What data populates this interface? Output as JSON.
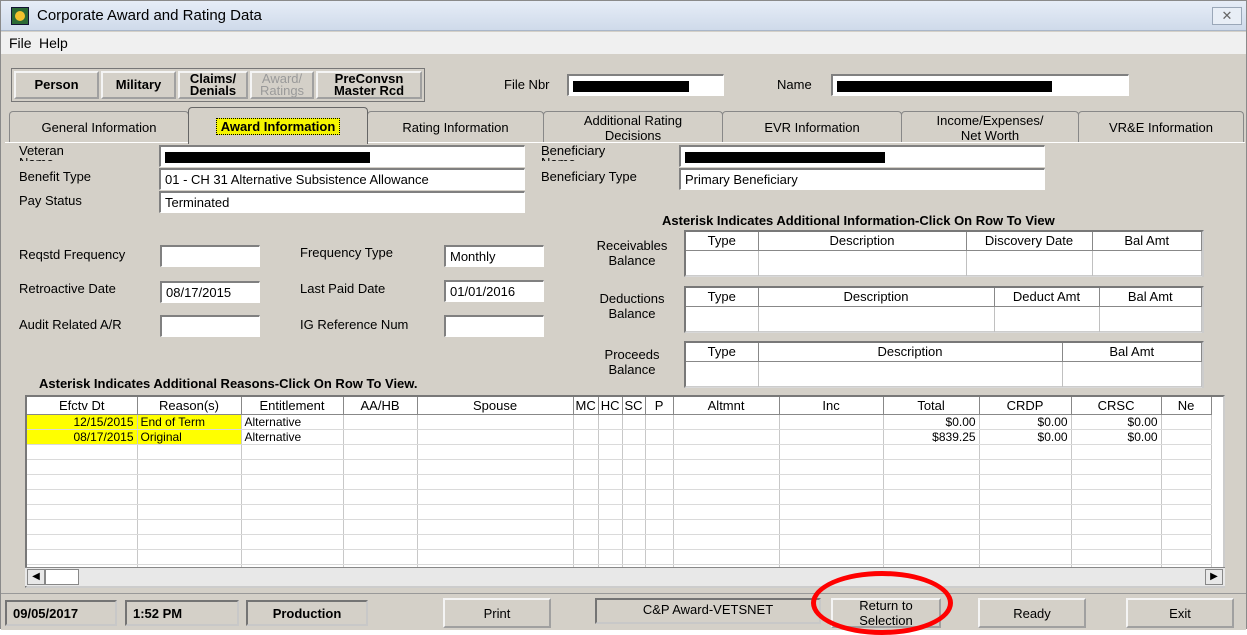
{
  "window": {
    "title": "Corporate Award and Rating Data",
    "close_glyph": "✕"
  },
  "menu": {
    "file": "File",
    "help": "Help"
  },
  "nav": [
    {
      "label": "Person",
      "enabled": true
    },
    {
      "label": "Military",
      "enabled": true
    },
    {
      "label": "Claims/\nDenials",
      "enabled": true
    },
    {
      "label": "Award/\nRatings",
      "enabled": false
    },
    {
      "label": "PreConvsn\nMaster Rcd",
      "enabled": true
    }
  ],
  "header": {
    "file_nbr_label": "File Nbr",
    "name_label": "Name"
  },
  "tabs": [
    {
      "label": "General Information"
    },
    {
      "label": "Award Information"
    },
    {
      "label": "Rating Information"
    },
    {
      "label": "Additional Rating\nDecisions"
    },
    {
      "label": "EVR Information"
    },
    {
      "label": "Income/Expenses/\nNet Worth"
    },
    {
      "label": "VR&E Information"
    }
  ],
  "fields": {
    "veteran_name_label": "Veteran\nName",
    "beneficiary_name_label": "Beneficiary\nName",
    "benefit_type_label": "Benefit Type",
    "benefit_type_value": "01 - CH 31 Alternative Subsistence Allowance",
    "beneficiary_type_label": "Beneficiary Type",
    "beneficiary_type_value": "Primary Beneficiary",
    "pay_status_label": "Pay Status",
    "pay_status_value": "Terminated",
    "reqstd_frequency_label": "Reqstd Frequency",
    "reqstd_frequency_value": "",
    "frequency_type_label": "Frequency Type",
    "frequency_type_value": "Monthly",
    "retroactive_date_label": "Retroactive Date",
    "retroactive_date_value": "08/17/2015",
    "last_paid_date_label": "Last Paid Date",
    "last_paid_date_value": "01/01/2016",
    "audit_related_label": "Audit Related A/R",
    "audit_related_value": "",
    "ig_reference_label": "IG Reference Num",
    "ig_reference_value": ""
  },
  "balances": {
    "heading": "Asterisk Indicates Additional Information-Click On Row To View",
    "receivables_label": "Receivables\nBalance",
    "receivables_cols": [
      "Type",
      "Description",
      "Discovery Date",
      "Bal Amt"
    ],
    "deductions_label": "Deductions\nBalance",
    "deductions_cols": [
      "Type",
      "Description",
      "Deduct Amt",
      "Bal Amt"
    ],
    "proceeds_label": "Proceeds\nBalance",
    "proceeds_cols": [
      "Type",
      "Description",
      "Bal Amt"
    ]
  },
  "award_grid": {
    "heading": "Asterisk Indicates Additional Reasons-Click On Row To View.",
    "columns": [
      "Efctv Dt",
      "Reason(s)",
      "Entitlement",
      "AA/HB",
      "Spouse",
      "MC",
      "HC",
      "SC",
      "P",
      "Altmnt",
      "Inc",
      "Total",
      "CRDP",
      "CRSC",
      "Ne"
    ],
    "rows": [
      [
        "12/15/2015",
        "End of Term",
        "Alternative",
        "",
        "",
        "",
        "",
        "",
        "",
        "",
        "",
        "$0.00",
        "$0.00",
        "$0.00",
        ""
      ],
      [
        "08/17/2015",
        "Original",
        "Alternative",
        "",
        "",
        "",
        "",
        "",
        "",
        "",
        "",
        "$839.25",
        "$0.00",
        "$0.00",
        ""
      ]
    ]
  },
  "status": {
    "date": "09/05/2017",
    "time": "1:52 PM",
    "env": "Production",
    "print": "Print",
    "app": "C&P Award-VETSNET",
    "return": "Return to\nSelection",
    "ready": "Ready",
    "exit": "Exit"
  }
}
